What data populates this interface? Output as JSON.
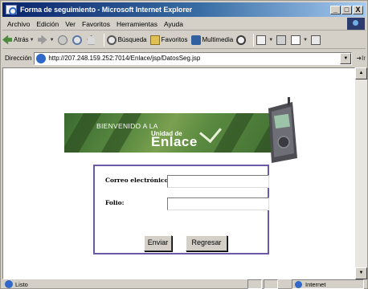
{
  "window": {
    "title": "Forma de seguimiento - Microsoft Internet Explorer",
    "controls": [
      "_",
      "□",
      "X"
    ]
  },
  "menu": {
    "items": [
      "Archivo",
      "Edición",
      "Ver",
      "Favoritos",
      "Herramientas",
      "Ayuda"
    ]
  },
  "toolbar": {
    "back_label": "Atrás",
    "search_label": "Búsqueda",
    "favorites_label": "Favoritos",
    "multimedia_label": "Multimedia"
  },
  "address": {
    "label": "Dirección",
    "url": "http://207.248.159.252:7014/Enlace/jsp/DatosSeg.jsp",
    "go_label": "Ir"
  },
  "banner": {
    "welcome": "BIENVENIDO A LA",
    "line1": "Unidad de",
    "line2": "Enlace"
  },
  "form": {
    "email_label": "Correo electrónico :",
    "email_value": "",
    "folio_label": "Folio:",
    "folio_value": "",
    "submit_label": "Enviar",
    "back_label": "Regresar"
  },
  "status": {
    "text": "Listo",
    "zone": "Internet"
  },
  "colors": {
    "titlebar": "#0a246a",
    "form_border": "#6a5aa8",
    "banner_green": "#5a8a40"
  }
}
